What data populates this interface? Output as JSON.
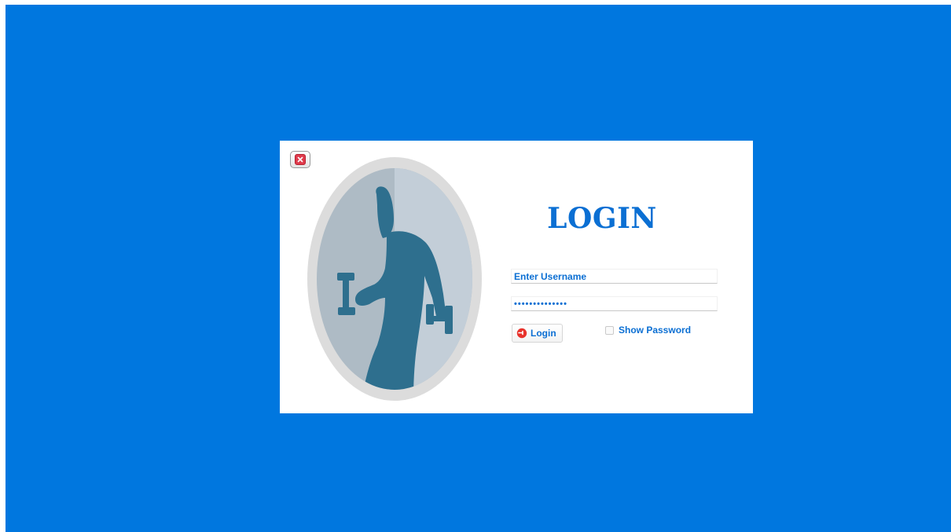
{
  "dialog": {
    "title": "LOGIN",
    "username_value": "Enter Username",
    "password_value": "••••••••••••••",
    "login_label": "Login",
    "show_password_label": "Show Password"
  },
  "icons": {
    "close": "close-icon",
    "login": "power-icon",
    "portrait": "fitness-man-dumbbells-icon"
  },
  "colors": {
    "desktop_background": "#0077df",
    "accent_text": "#0b6fd3",
    "close_red": "#e03b4c",
    "login_icon_red": "#e8322b",
    "silhouette": "#2e6f8e"
  }
}
